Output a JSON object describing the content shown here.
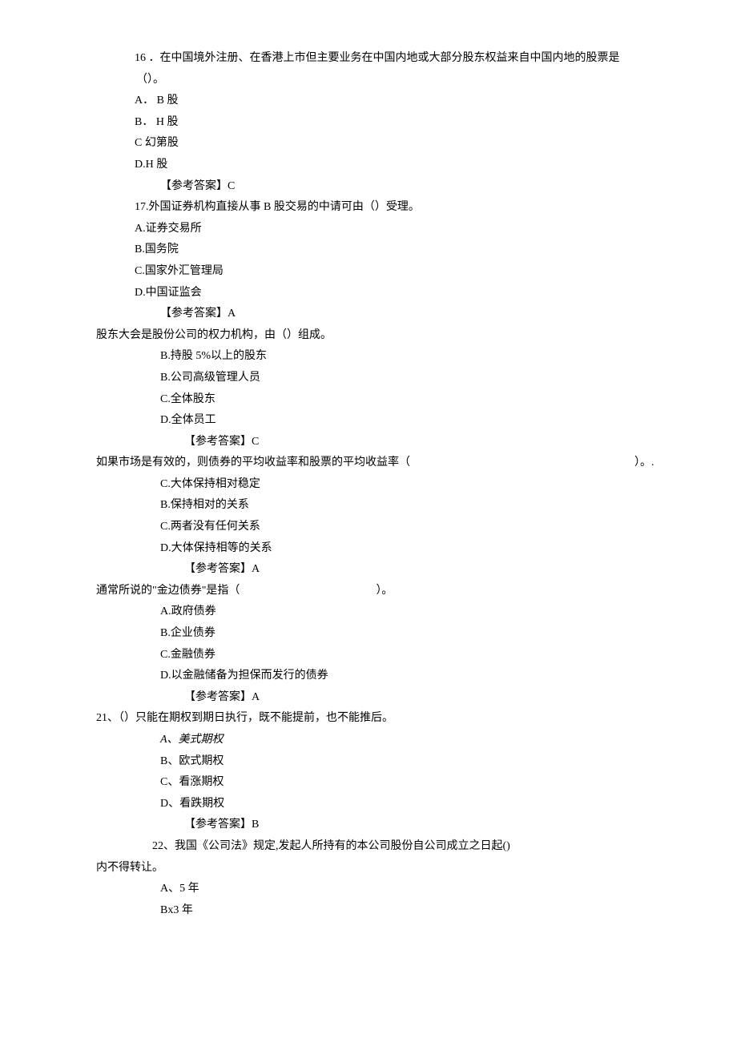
{
  "q16": {
    "stem_a": "16 ．在中国境外注册、在香港上市但主要业务在中国内地或大部分股东权益来自中国内地的股票是",
    "stem_b": "（）。",
    "optA": "A． B 股",
    "optB": "B． H 股",
    "optC": "C 幻第股",
    "optD": "D.H 股",
    "ans": "【参考答案】C"
  },
  "q17": {
    "stem": "17.外国证券机构直接从事 B 股交易的中请可由（）受理。",
    "optA": "A.证券交易所",
    "optB": "B.国务院",
    "optC": "C.国家外汇管理局",
    "optD": "D.中国证监会",
    "ans": "【参考答案】A"
  },
  "q18": {
    "stem": "股东大会是股份公司的权力机构，由（）组成。",
    "optA": "B.持股 5%以上的股东",
    "optB": "B.公司高级管理人员",
    "optC": "C.全体股东",
    "optD": "D.全体员工",
    "ans": "【参考答案】C"
  },
  "q19": {
    "stem_a": "如果市场是有效的，则债券的平均收益率和股票的平均收益率（",
    "stem_b": "）。.",
    "optA": "C.大体保持相对稳定",
    "optB": "B.保持相对的关系",
    "optC": "C.两者没有任何关系",
    "optD": "D.大体保持相等的关系",
    "ans": "【参考答案】A"
  },
  "q20": {
    "stem_a": "通常所说的\"金边债券\"是指（",
    "stem_b": "）。",
    "optA": "A.政府债券",
    "optB": "B.企业债券",
    "optC": "C.金融债券",
    "optD": "D.以金融储备为担保而发行的债券",
    "ans": "【参考答案】A"
  },
  "q21": {
    "stem": "21、（）只能在期权到期日执行，既不能提前，也不能推后。",
    "optA": "A、美式期权",
    "optB": "B、欧式期权",
    "optC": "C、看涨期权",
    "optD": "D、看跌期权",
    "ans": "【参考答案】B"
  },
  "q22": {
    "stem_a": "22、我国《公司法》规定,发起人所持有的本公司股份自公司成立之日起()",
    "stem_b": "内不得转让。",
    "optA": "A、5 年",
    "optB": "Bx3 年"
  }
}
